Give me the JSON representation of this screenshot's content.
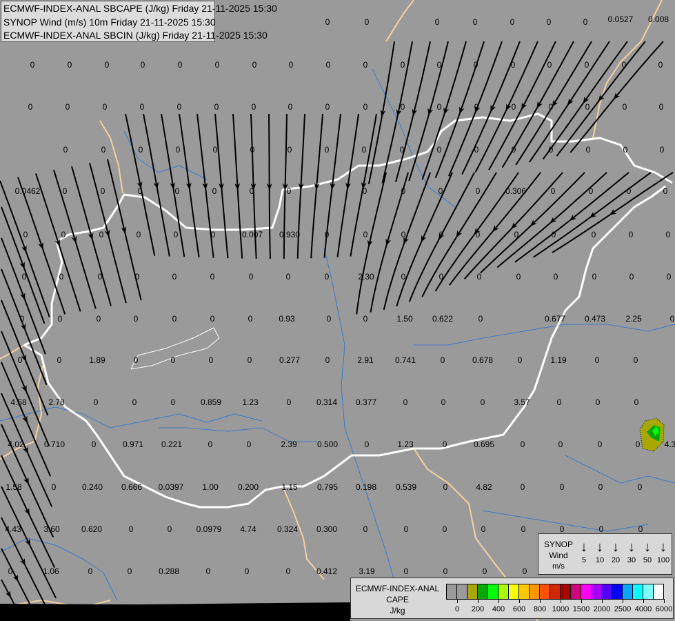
{
  "titles": [
    "ECMWF-INDEX-ANAL SBCAPE (J/kg) Friday 21-11-2025 15:30",
    "SYNOP Wind (m/s) 10m Friday 21-11-2025 15:30",
    "ECMWF-INDEX-ANAL SBCIN (J/kg) Friday 21-11-2025 15:30"
  ],
  "cape_values": {
    "row1": [
      "0",
      "0",
      "0",
      "0",
      "0",
      "0",
      "0",
      "0.0527",
      "0.008"
    ],
    "row2": [
      "0",
      "0",
      "0",
      "0",
      "0",
      "0",
      "0",
      "0",
      "0",
      "0",
      "0",
      "0",
      "0",
      "0",
      "0",
      "0",
      "0",
      "0"
    ],
    "row3": [
      "0",
      "0",
      "0",
      "0",
      "0",
      "0",
      "0",
      "0",
      "0",
      "0",
      "0",
      "0",
      "0",
      "0",
      "0",
      "0",
      "0",
      "0"
    ],
    "row4": [
      "0",
      "0",
      "0",
      "0",
      "0",
      "0",
      "0",
      "0",
      "0",
      "0",
      "0",
      "0",
      "0",
      "0",
      "0",
      "0",
      "0"
    ],
    "row5": [
      "0.0462",
      "0",
      "0",
      "0",
      "0",
      "0",
      "0",
      "0",
      "0",
      "0",
      "0",
      "0",
      "0.306",
      "0",
      "0",
      "0",
      "0"
    ],
    "row6": [
      "0",
      "0",
      "0",
      "0",
      "0",
      "0",
      "0.007",
      "0.930",
      "0",
      "0",
      "0",
      "0",
      "0",
      "0",
      "0",
      "0",
      "0",
      "0"
    ],
    "row7": [
      "0",
      "0",
      "0",
      "0",
      "0",
      "0",
      "0",
      "0",
      "0",
      "2.30",
      "0",
      "0",
      "0",
      "0",
      "0",
      "0",
      "0",
      "0"
    ],
    "row8": [
      "0",
      "0",
      "0",
      "0",
      "0",
      "0",
      "0",
      "0.93",
      "0",
      "0",
      "1.50",
      "0.622",
      "0",
      "0.677",
      "0.473",
      "2.25",
      "0"
    ],
    "row9": [
      "0",
      "0",
      "1.89",
      "0",
      "0",
      "0",
      "0",
      "0.277",
      "0",
      "2.91",
      "0.741",
      "0",
      "0.678",
      "0",
      "1.19",
      "0",
      "0"
    ],
    "row10": [
      "4.58",
      "2.78",
      "0",
      "0",
      "0",
      "0.859",
      "1.23",
      "0",
      "0.314",
      "0.377",
      "0",
      "0",
      "0",
      "3.57",
      "0",
      "0",
      "0"
    ],
    "row11": [
      "4.02",
      "0.710",
      "0",
      "0.971",
      "0.221",
      "0",
      "0",
      "2.39",
      "0.500",
      "0",
      "1.23",
      "0",
      "0.695",
      "0",
      "0",
      "0",
      "0",
      "4.3"
    ],
    "row12": [
      "1.58",
      "0",
      "0.240",
      "0.666",
      "0.0397",
      "1.00",
      "0.200",
      "1.15",
      "0.795",
      "0.198",
      "0.539",
      "0",
      "4.82",
      "0",
      "0",
      "0",
      "0"
    ],
    "row13": [
      "4.43",
      "3.60",
      "0.620",
      "0",
      "0",
      "0.0979",
      "4.74",
      "0.324",
      "0.300",
      "0",
      "0",
      "0",
      "0",
      "0",
      "0",
      "0",
      "0"
    ],
    "row14": [
      "0",
      "1.06",
      "0",
      "0",
      "0.288",
      "0",
      "0",
      "0",
      "0.412",
      "3.19",
      "0",
      "0",
      "0",
      "0"
    ]
  },
  "synop_legend": {
    "title_lines": [
      "SYNOP",
      "Wind",
      "m/s"
    ],
    "arrow_icon": "down-arrow-icon",
    "speeds": [
      "5",
      "10",
      "20",
      "30",
      "50",
      "100"
    ]
  },
  "cape_legend": {
    "title_lines": [
      "ECMWF-INDEX-ANAL",
      "CAPE",
      "J/kg"
    ],
    "colors": [
      "#9a9a9a",
      "#9a9a9a",
      "#a8a800",
      "#00a800",
      "#00ff00",
      "#a8ff00",
      "#ffff00",
      "#ffc800",
      "#ff9600",
      "#ff5000",
      "#d22800",
      "#a80000",
      "#d2007f",
      "#ff00ff",
      "#a800ff",
      "#5000ff",
      "#0000ff",
      "#00a8ff",
      "#00ffff",
      "#80ffff",
      "#ffffff"
    ],
    "ticks": [
      "0",
      "200",
      "400",
      "600",
      "800",
      "1000",
      "1500",
      "2000",
      "2500",
      "4000",
      "6000"
    ]
  },
  "colors": {
    "background": "#9a9a9a",
    "national_border": "#ffffff",
    "regional_border": "#f0d2a0",
    "river": "#3c78c8",
    "streamline": "#000000"
  }
}
